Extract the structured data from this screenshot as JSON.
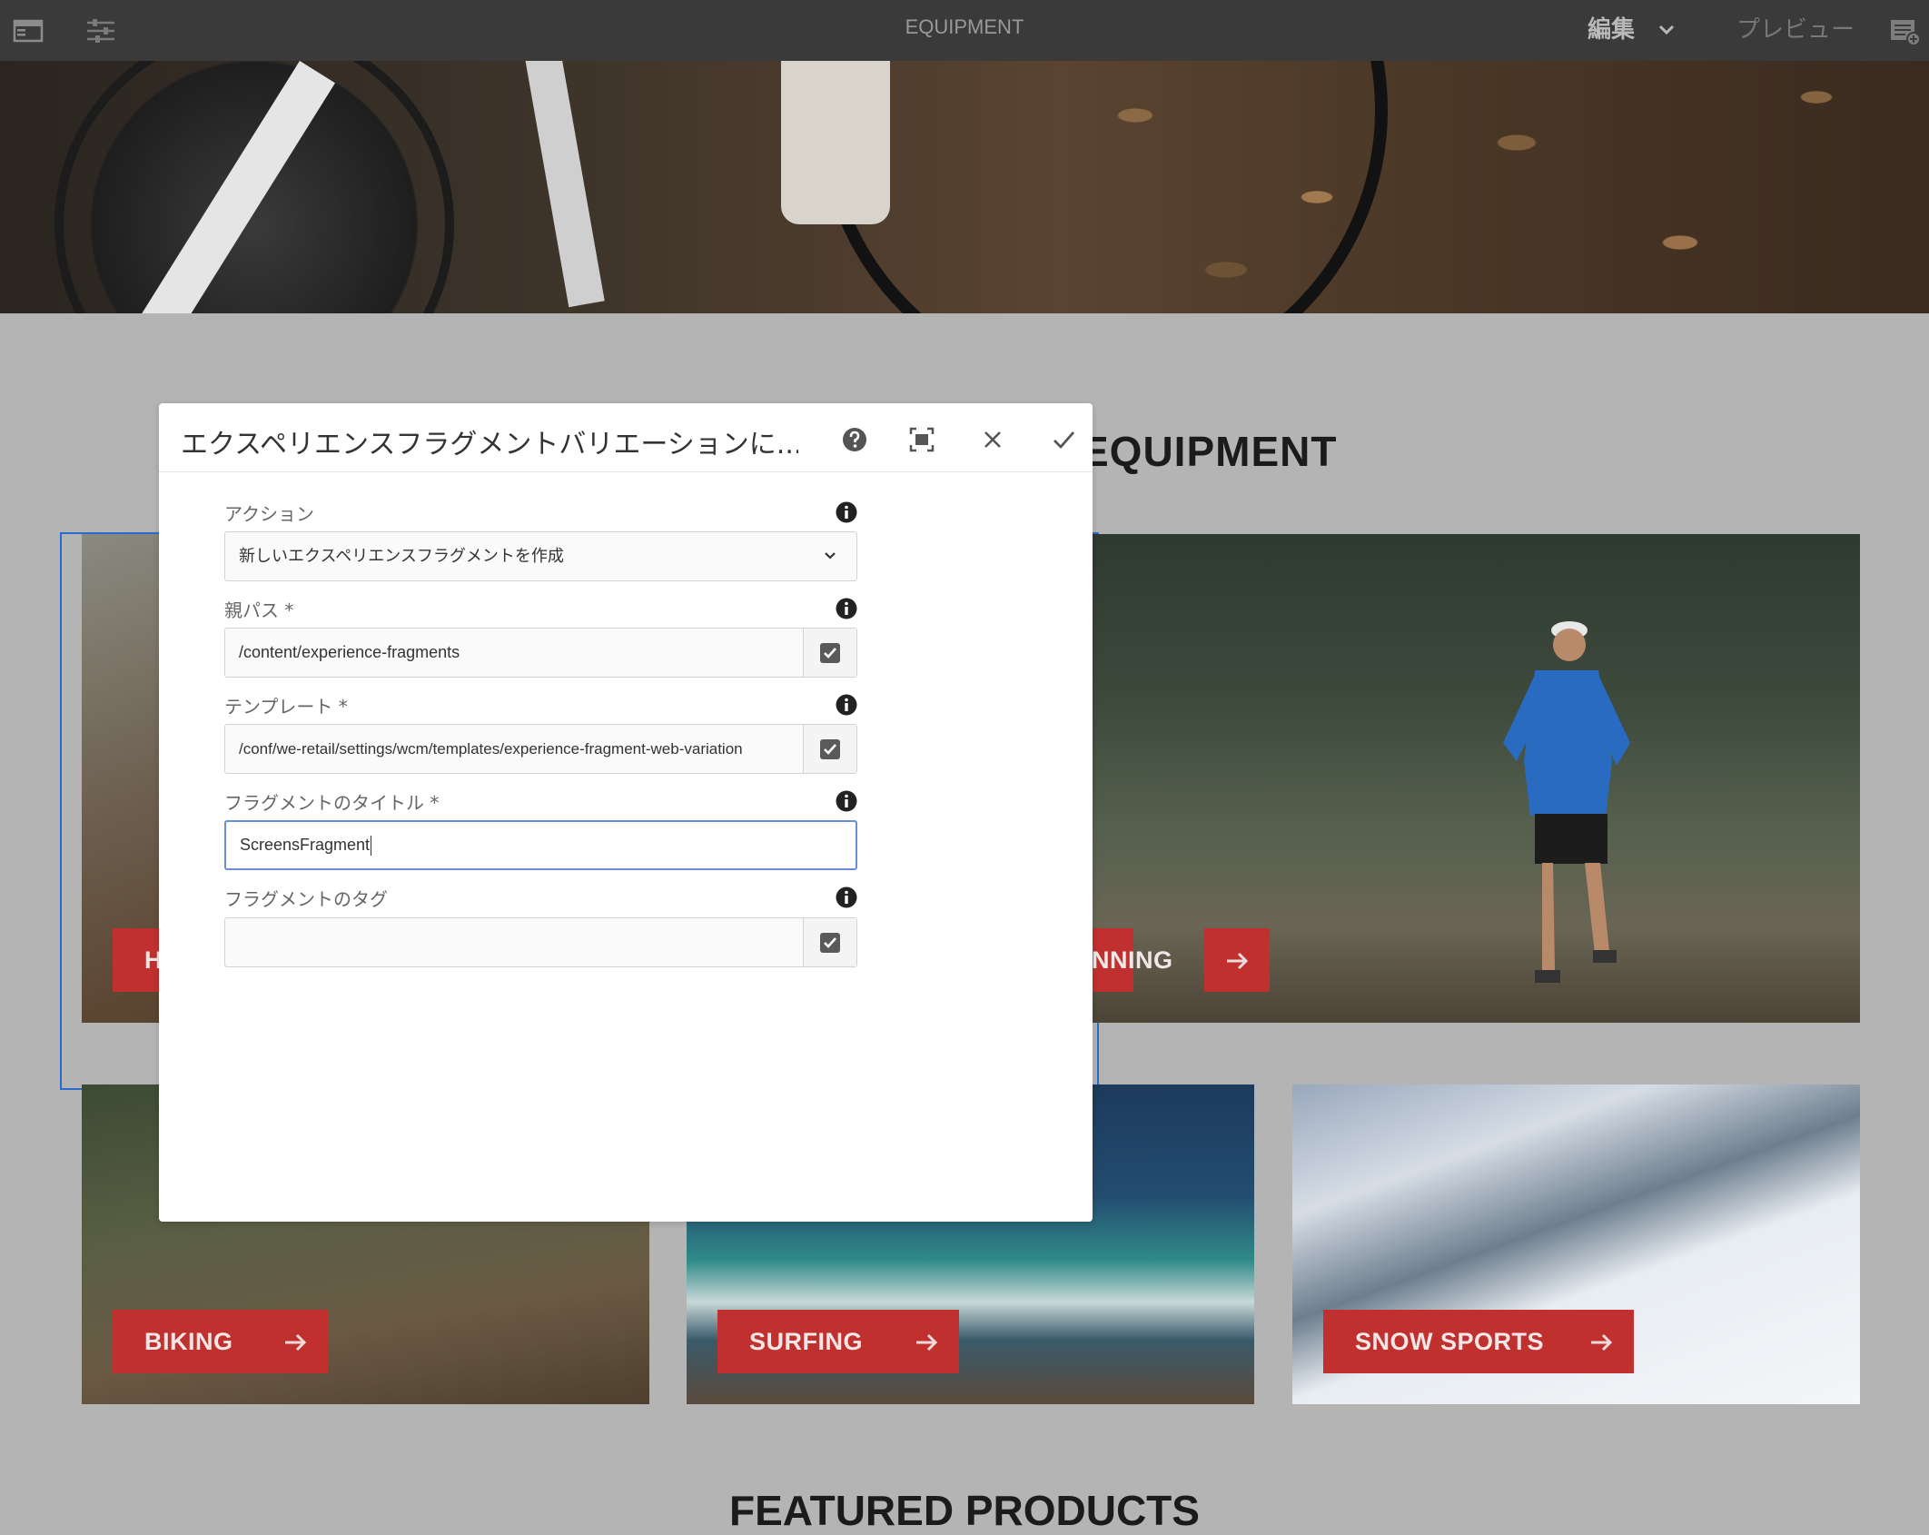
{
  "topbar": {
    "title": "EQUIPMENT",
    "edit_label": "編集",
    "preview_label": "プレビュー",
    "icons": [
      "sidepanel-toggle-icon",
      "properties-icon",
      "chevron-down-icon",
      "annotate-icon"
    ]
  },
  "page": {
    "heading": "EQUIPMENT",
    "tiles": [
      {
        "id": "hiking",
        "label": "H"
      },
      {
        "id": "running",
        "label": "NNING"
      },
      {
        "id": "biking",
        "label": "BIKING"
      },
      {
        "id": "surfing",
        "label": "SURFING"
      },
      {
        "id": "snow",
        "label": "SNOW SPORTS"
      }
    ],
    "featured_heading": "FEATURED PRODUCTS"
  },
  "dialog": {
    "title": "エクスペリエンスフラグメントバリエーションに...",
    "fields": {
      "action": {
        "label": "アクション",
        "value": "新しいエクスペリエンスフラグメントを作成"
      },
      "parent_path": {
        "label": "親パス *",
        "value": "/content/experience-fragments"
      },
      "template": {
        "label": "テンプレート *",
        "value": "/conf/we-retail/settings/wcm/templates/experience-fragment-web-variation"
      },
      "fragment_title": {
        "label": "フラグメントのタイトル *",
        "value": "ScreensFragment"
      },
      "fragment_tags": {
        "label": "フラグメントのタグ",
        "value": ""
      }
    }
  },
  "colors": {
    "topbar_bg": "#3a3a3a",
    "page_bg": "#b4b4b4",
    "cta_red": "#c0302e",
    "selection_blue": "#2a6bd0",
    "focus_blue": "#6a8fd8"
  }
}
